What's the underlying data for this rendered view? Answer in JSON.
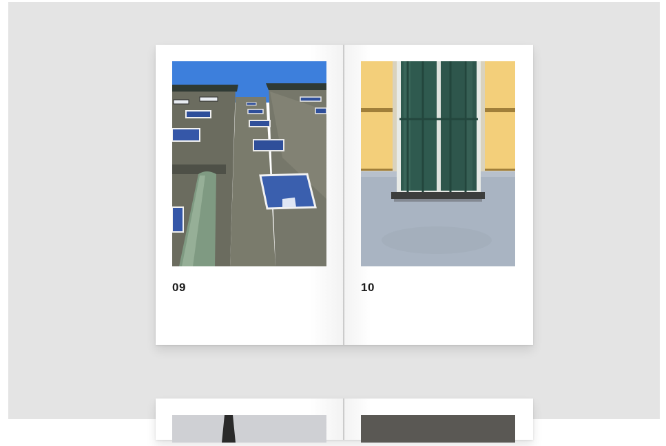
{
  "spreads": [
    {
      "left_page": {
        "number": "09",
        "photo": "building-facade-photo"
      },
      "right_page": {
        "number": "10",
        "photo": "barred-window-photo"
      }
    },
    {
      "left_page": {
        "photo": "partial-photo"
      },
      "right_page": {
        "photo": "partial-photo"
      }
    }
  ],
  "colors": {
    "background": "#e4e4e4",
    "page": "#ffffff",
    "sky": "#3d7fdc",
    "facade": "#6e6f62",
    "shutter_yellow": "#f3cf7a",
    "wall_blue": "#a8b3c1",
    "window_green": "#2f5a4f"
  }
}
